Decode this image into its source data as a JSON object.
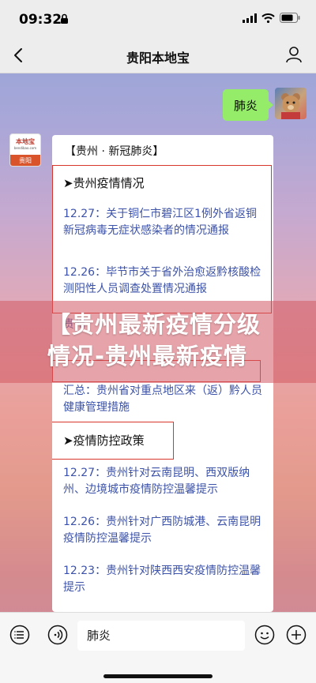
{
  "status": {
    "time": "09:32"
  },
  "nav": {
    "title": "贵阳本地宝"
  },
  "chat": {
    "user_message": "肺炎",
    "bot": {
      "avatar_name": "本地宝",
      "avatar_url": "bendibao.com",
      "avatar_city": "贵阳"
    },
    "card": {
      "header": "【贵州 · 新冠肺炎】",
      "section1": "➤贵州疫情情况",
      "items1": [
        {
          "text": "12.27：关于铜仁市碧江区1例外省返铜新冠病毒无症状感染者的情况通报"
        },
        {
          "text": "12.26：毕节市关于省外治愈返黔核酸检测阳性人员调查处置情况通报"
        },
        {
          "text": "汇总：贵州省对重点地区来（返）黔人员健康管理措施"
        }
      ],
      "partial_item": "贵州",
      "section2": "➤疫情防控政策",
      "items2": [
        {
          "text": "12.27：贵州针对云南昆明、西双版纳州、边境城市疫情防控温馨提示"
        },
        {
          "text": "12.26：贵州针对广西防城港、云南昆明疫情防控温馨提示"
        },
        {
          "text": "12.23：贵州针对陕西西安疫情防控温馨提示"
        }
      ]
    }
  },
  "overlay": {
    "line1": "【贵州最新疫情分级",
    "line2": "情况-贵州最新疫情"
  },
  "bottom": {
    "input_value": "肺炎"
  },
  "colors": {
    "link": "#3c52a8",
    "accent_red": "#d9362b",
    "bubble_green": "#95ec69"
  }
}
